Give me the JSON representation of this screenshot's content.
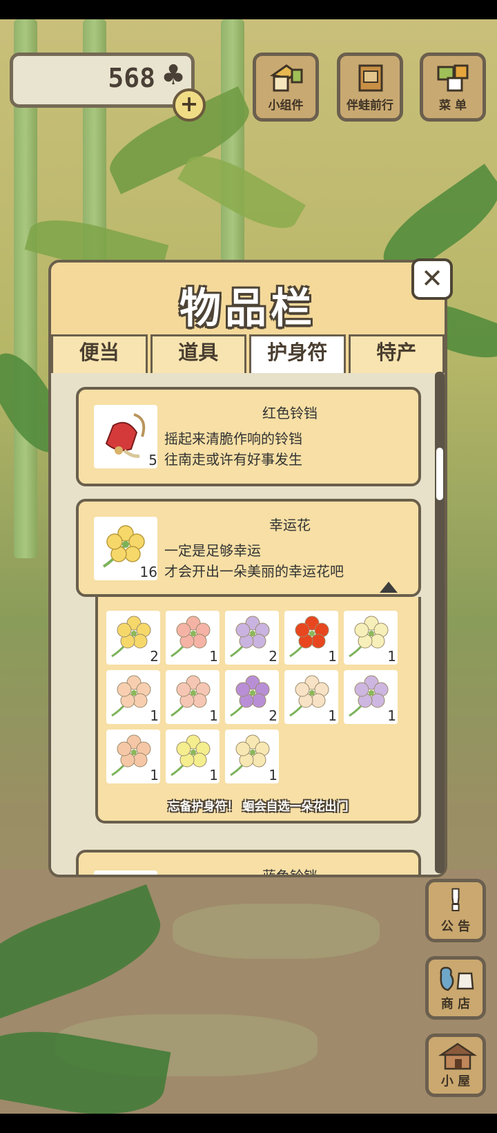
{
  "hud": {
    "clover_count": "568"
  },
  "top_buttons": [
    {
      "label": "小组件",
      "icon": "widget-icon"
    },
    {
      "label": "伴蛙前行",
      "icon": "album-icon"
    },
    {
      "label": "菜 单",
      "icon": "menu-icon"
    }
  ],
  "panel": {
    "title": "物品栏",
    "tabs": [
      "便当",
      "道具",
      "护身符",
      "特产"
    ],
    "active_tab": "护身符"
  },
  "items": [
    {
      "name": "红色铃铛",
      "desc1": "摇起来清脆作响的铃铛",
      "desc2": "往南走或许有好事发生",
      "qty": "5"
    },
    {
      "name": "幸运花",
      "desc1": "一定是足够幸运",
      "desc2": "才会开出一朵美丽的幸运花吧",
      "qty": "16"
    },
    {
      "name": "蓝色铃铛"
    }
  ],
  "flowers": [
    {
      "color": "#f6d86a",
      "qty": "2"
    },
    {
      "color": "#f5b3a6",
      "qty": "1"
    },
    {
      "color": "#c9b3e0",
      "qty": "2"
    },
    {
      "color": "#e8461f",
      "qty": "1"
    },
    {
      "color": "#f7efb9",
      "qty": "1"
    },
    {
      "color": "#f7cfb0",
      "qty": "1"
    },
    {
      "color": "#f6c6b4",
      "qty": "1"
    },
    {
      "color": "#b88fd6",
      "qty": "2"
    },
    {
      "color": "#f8e2c6",
      "qty": "1"
    },
    {
      "color": "#cdb6e0",
      "qty": "1"
    },
    {
      "color": "#f5c7a6",
      "qty": "1"
    },
    {
      "color": "#f4ee8e",
      "qty": "1"
    },
    {
      "color": "#f7e8b3",
      "qty": "1"
    }
  ],
  "grid_note": "忘备护身符！ 蛔会自选一朵花出门",
  "side_buttons": [
    {
      "label": "公 告",
      "icon": "exclamation-icon"
    },
    {
      "label": "商 店",
      "icon": "shop-bag-icon"
    },
    {
      "label": "小 屋",
      "icon": "house-icon"
    }
  ]
}
